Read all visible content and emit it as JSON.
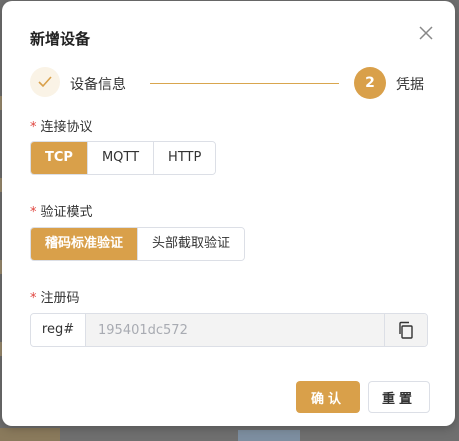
{
  "dialog": {
    "title": "新增设备",
    "close_icon": "close-icon"
  },
  "steps": [
    {
      "label": "设备信息",
      "status": "done",
      "icon": "check-icon"
    },
    {
      "number": "2",
      "label": "凭据",
      "status": "active"
    }
  ],
  "protocol": {
    "label": "连接协议",
    "required_mark": "*",
    "options": [
      "TCP",
      "MQTT",
      "HTTP"
    ],
    "selected": "TCP"
  },
  "auth_mode": {
    "label": "验证模式",
    "required_mark": "*",
    "options": [
      "稽码标准验证",
      "头部截取验证"
    ],
    "selected": "稽码标准验证"
  },
  "reg_code": {
    "label": "注册码",
    "required_mark": "*",
    "prefix": "reg#",
    "value": "195401dc572",
    "copy_icon": "copy-icon"
  },
  "footer": {
    "confirm_label": "确认",
    "reset_label": "重置"
  },
  "colors": {
    "accent": "#d9a04a",
    "required": "#e0443e"
  }
}
